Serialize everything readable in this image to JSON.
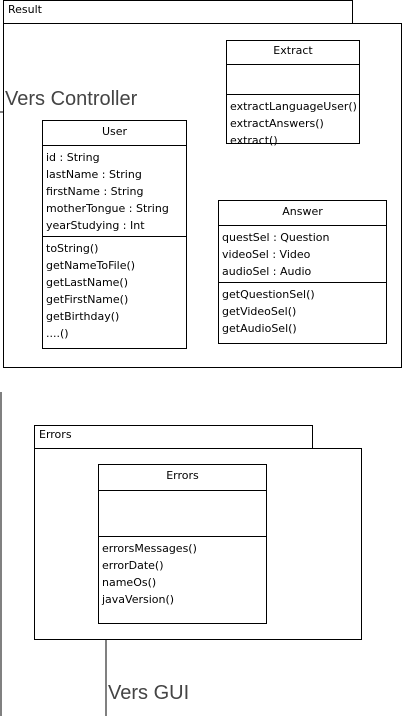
{
  "packages": {
    "result": {
      "label": "Result"
    },
    "errors": {
      "label": "Errors"
    }
  },
  "classes": {
    "extract": {
      "name": "Extract",
      "attributes": [],
      "operations": [
        "extractLanguageUser()",
        "extractAnswers()",
        "extract()"
      ]
    },
    "user": {
      "name": "User",
      "attributes": [
        "id : String",
        "lastName : String",
        "firstName : String",
        "motherTongue : String",
        "yearStudying : Int"
      ],
      "operations": [
        "toString()",
        "getNameToFile()",
        "getLastName()",
        "getFirstName()",
        "getBirthday()",
        "....()"
      ]
    },
    "answer": {
      "name": "Answer",
      "attributes": [
        "questSel : Question",
        "videoSel : Video",
        "audioSel : Audio"
      ],
      "operations": [
        "getQuestionSel()",
        "getVideoSel()",
        "getAudioSel()"
      ]
    },
    "errors": {
      "name": "Errors",
      "attributes": [],
      "operations": [
        "errorsMessages()",
        "errorDate()",
        "nameOs()",
        "javaVersion()"
      ]
    }
  },
  "notes": {
    "vers_controller": "Vers Controller",
    "vers_gui": "Vers GUI"
  }
}
